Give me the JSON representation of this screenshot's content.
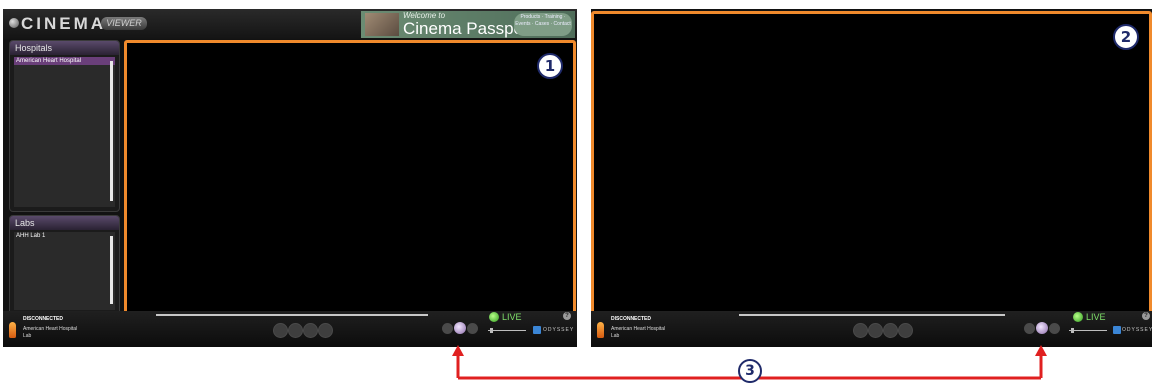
{
  "labels": {
    "one": "1",
    "two": "2",
    "three": "3"
  },
  "app": {
    "logo_text": "CINEMA",
    "logo_sub": "VIEWER",
    "passport": {
      "welcome": "Welcome to",
      "title": "Cinema Passport",
      "links": "Products · Training · Events · Cases · Contact"
    },
    "hospitals": {
      "header": "Hospitals",
      "items": [
        "American Heart Hospital"
      ]
    },
    "labs": {
      "header": "Labs",
      "items": [
        "AHH Lab 1"
      ]
    },
    "status": {
      "state": "DISCONNECTED",
      "hospital": "American Heart Hospital",
      "lab": "Lab"
    },
    "live_label": "LIVE",
    "help_label": "?",
    "sponsor": "ODYSSEY"
  },
  "colors": {
    "viewer_border": "#f08a2c",
    "arrow": "#e02020",
    "live": "#7fe06a"
  }
}
